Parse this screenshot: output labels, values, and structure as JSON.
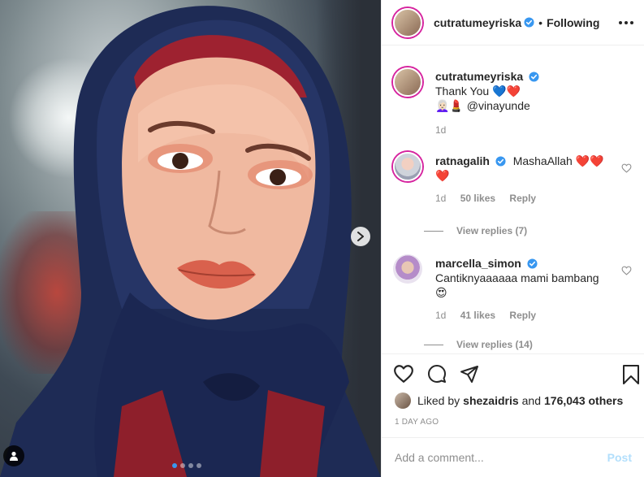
{
  "post": {
    "carousel": {
      "dot_count": 4,
      "active_index": 0
    }
  },
  "header": {
    "username": "cutratumeyriska",
    "separator": "•",
    "follow_status": "Following"
  },
  "comments": [
    {
      "username": "cutratumeyriska",
      "lines": [
        "Thank You 💙❤️",
        "👩🏻‍🦳💄 @vinayunde"
      ],
      "time": "1d"
    },
    {
      "username": "ratnagalih",
      "text": "MashaAllah ❤️❤️",
      "text2": "❤️",
      "time": "1d",
      "likes": "50 likes",
      "reply": "Reply",
      "view_replies": "View replies (7)"
    },
    {
      "username": "marcella_simon",
      "text": "Cantiknyaaaaaa mami bambang",
      "text2": "😍",
      "time": "1d",
      "likes": "41 likes",
      "reply": "Reply",
      "view_replies": "View replies (14)"
    }
  ],
  "likes": {
    "prefix": "Liked by",
    "user": "shezaidris",
    "middle": "and",
    "count": "176,043 others"
  },
  "time_ago": "1 DAY AGO",
  "add_comment": {
    "placeholder": "Add a comment...",
    "post_label": "Post"
  },
  "colors": {
    "link": "#3897f0",
    "verified": "#3897f0",
    "heart": "#ed4956",
    "muted": "#8e8e8e"
  }
}
